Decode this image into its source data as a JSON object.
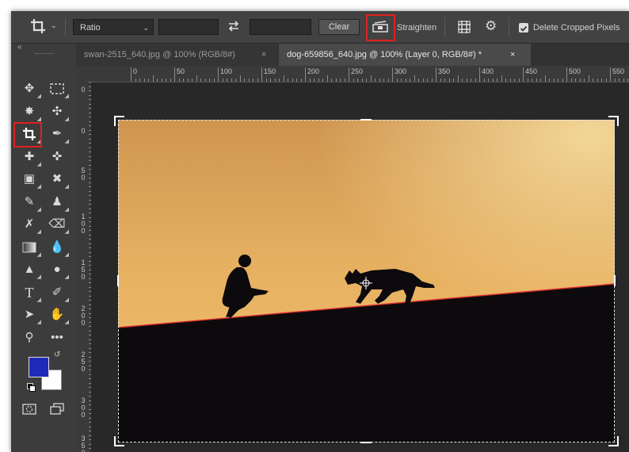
{
  "options_bar": {
    "ratio_label": "Ratio",
    "width_value": "",
    "height_value": "",
    "clear_label": "Clear",
    "straighten_label": "Straighten",
    "delete_cropped_label": "Delete Cropped Pixels",
    "delete_cropped_checked": true
  },
  "tabs": [
    {
      "label": "swan-2515_640.jpg @ 100% (RGB/8#)",
      "close": "×",
      "active": false
    },
    {
      "label": "dog-659856_640.jpg @ 100% (Layer 0, RGB/8#) *",
      "close": "×",
      "active": true
    }
  ],
  "toolbar": {
    "collapse_glyph": "«",
    "active_tool": "crop-tool",
    "foreground_color": "#1f2bb8",
    "background_color": "#ffffff"
  },
  "ruler": {
    "h_labels": [
      "0",
      "50",
      "100",
      "150",
      "200",
      "250",
      "300",
      "350",
      "400",
      "450",
      "500",
      "550"
    ],
    "v_labels": [
      "0",
      "0",
      "50",
      "100",
      "150",
      "200",
      "250",
      "300",
      "350"
    ]
  },
  "colors": {
    "accent_highlight": "#e02020",
    "horizon_line": "#e03030",
    "sky_top": "#d39a55",
    "sky_bottom": "#f0c070",
    "ground": "#0c0a0c"
  }
}
